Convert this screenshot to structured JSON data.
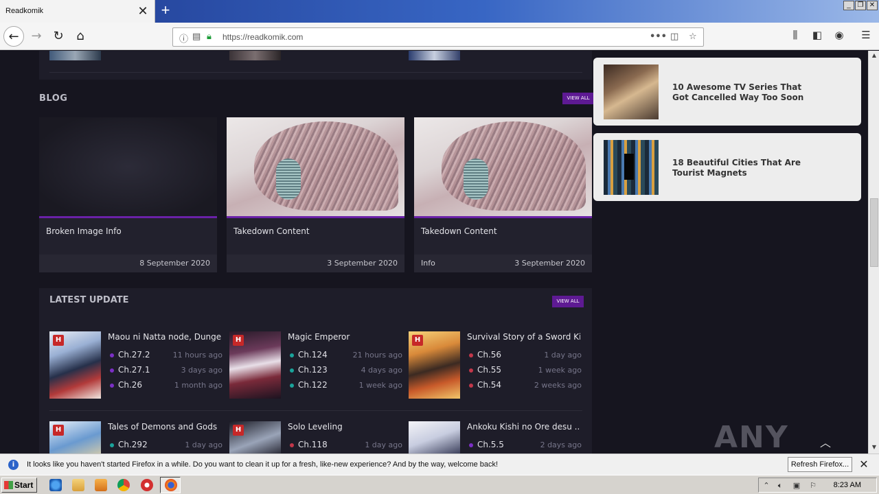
{
  "browser": {
    "tab_title": "Readkomik",
    "tab_close": "✕",
    "new_tab": "+",
    "url": "https://readkomik.com",
    "window_controls": [
      "_",
      "❐",
      "✕"
    ],
    "nav_icons": [
      "back-icon",
      "forward-icon",
      "reload-icon",
      "home-icon"
    ],
    "url_actions": [
      "more-icon",
      "pocket-icon",
      "bookmark-star-icon"
    ],
    "toolbar_icons": [
      "library-icon",
      "sidebar-icon",
      "account-icon",
      "menu-icon"
    ]
  },
  "blog": {
    "title": "BLOG",
    "view_all": "VIEW ALL",
    "posts": [
      {
        "title": "Broken Image Info",
        "category": "",
        "date": "8 September 2020"
      },
      {
        "title": "Takedown Content",
        "category": "",
        "date": "3 September 2020"
      },
      {
        "title": "Takedown Content",
        "category": "Info",
        "date": "3 September 2020"
      }
    ]
  },
  "latest": {
    "title": "LATEST UPDATE",
    "view_all": "VIEW ALL",
    "badge": "H",
    "items": [
      {
        "title": "Maou ni Natta node, Dunge...",
        "dot_color": "#7b2fc5",
        "chapters": [
          {
            "ch": "Ch.27.2",
            "ago": "11 hours ago"
          },
          {
            "ch": "Ch.27.1",
            "ago": "3 days ago"
          },
          {
            "ch": "Ch.26",
            "ago": "1 month ago"
          }
        ]
      },
      {
        "title": "Magic Emperor",
        "dot_color": "#1aa39a",
        "chapters": [
          {
            "ch": "Ch.124",
            "ago": "21 hours ago"
          },
          {
            "ch": "Ch.123",
            "ago": "4 days ago"
          },
          {
            "ch": "Ch.122",
            "ago": "1 week ago"
          }
        ]
      },
      {
        "title": "Survival Story of a Sword Ki...",
        "dot_color": "#c2374a",
        "chapters": [
          {
            "ch": "Ch.56",
            "ago": "1 day ago"
          },
          {
            "ch": "Ch.55",
            "ago": "1 week ago"
          },
          {
            "ch": "Ch.54",
            "ago": "2 weeks ago"
          }
        ]
      },
      {
        "title": "Tales of Demons and Gods",
        "dot_color": "#1aa39a",
        "chapters": [
          {
            "ch": "Ch.292",
            "ago": "1 day ago"
          }
        ]
      },
      {
        "title": "Solo Leveling",
        "dot_color": "#c2374a",
        "chapters": [
          {
            "ch": "Ch.118",
            "ago": "1 day ago"
          }
        ]
      },
      {
        "title": "Ankoku Kishi no Ore desu ...",
        "dot_color": "#7b2fc5",
        "chapters": [
          {
            "ch": "Ch.5.5",
            "ago": "2 days ago"
          }
        ]
      }
    ]
  },
  "ads": [
    {
      "text": "10 Awesome TV Series That Got Cancelled Way Too Soon"
    },
    {
      "text": "18 Beautiful Cities That Are Tourist Magnets"
    }
  ],
  "watermark": "ANY RUN",
  "notification": {
    "message": "It looks like you haven't started Firefox in a while. Do you want to clean it up for a fresh, like-new experience? And by the way, welcome back!",
    "button": "Refresh Firefox...",
    "close": "✕"
  },
  "taskbar": {
    "start": "Start",
    "clock": "8:23 AM"
  }
}
